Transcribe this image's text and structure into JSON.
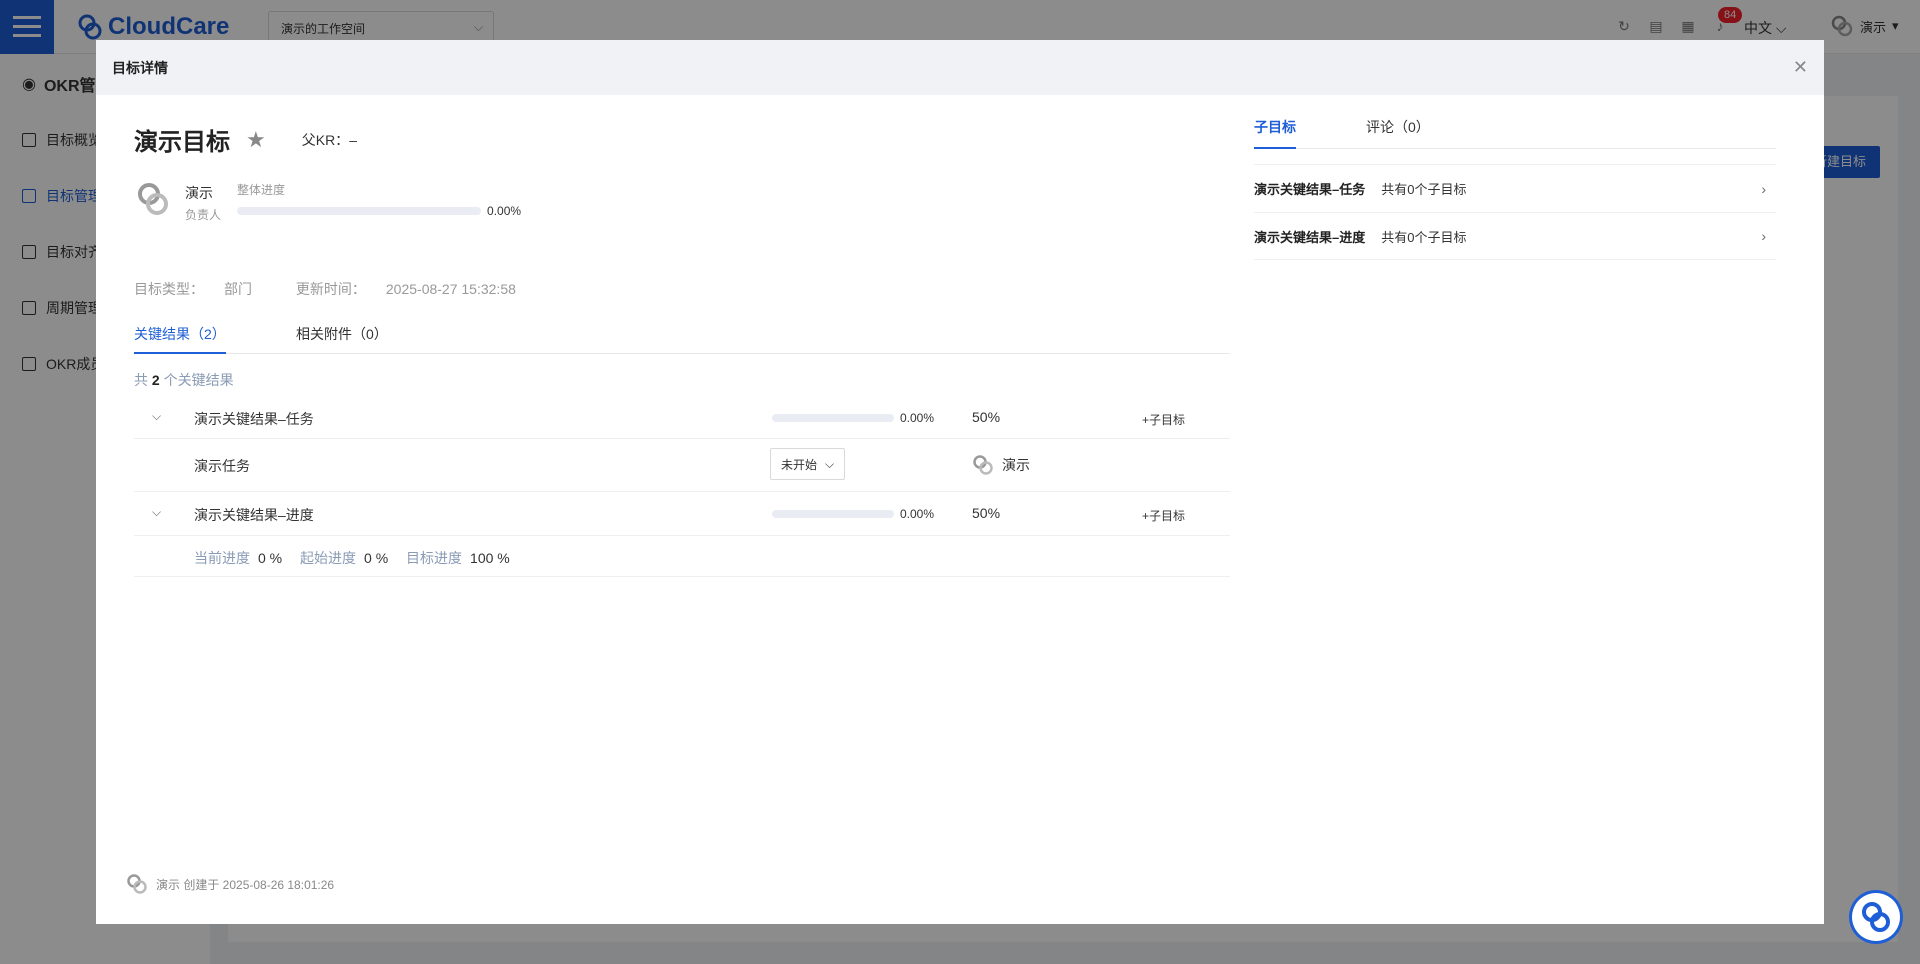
{
  "app": {
    "logo_text": "CloudCare",
    "workspace": "演示的工作空间",
    "notification_count": "84",
    "language": "中文",
    "user_name": "演示",
    "new_button": "新建目标"
  },
  "sidebar": {
    "title": "OKR管",
    "items": [
      {
        "label": "目标概览"
      },
      {
        "label": "目标管理"
      },
      {
        "label": "目标对齐"
      },
      {
        "label": "周期管理"
      },
      {
        "label": "OKR成员"
      }
    ]
  },
  "modal": {
    "title": "目标详情",
    "objective": {
      "name": "演示目标",
      "parent_kr_label": "父KR：",
      "parent_kr_value": "–",
      "owner_name": "演示",
      "owner_role": "负责人",
      "progress_label": "整体进度",
      "progress_value": "0.00%",
      "progress_fraction": 0.0,
      "type_label": "目标类型：",
      "type_value": "部门",
      "updated_label": "更新时间：",
      "updated_value": "2025-08-27 15:32:58"
    },
    "tabs": [
      {
        "label": "关键结果（2）"
      },
      {
        "label": "相关附件（0）"
      }
    ],
    "kr_count_prefix": "共",
    "kr_count_num": "2",
    "kr_count_suffix": "个关键结果",
    "key_results": [
      {
        "name": "演示关键结果–任务",
        "progress": "0.00%",
        "progress_fraction": 0.0,
        "weight": "50%",
        "add_label": "+子目标",
        "task": {
          "name": "演示任务",
          "status": "未开始",
          "assignee": "演示"
        }
      },
      {
        "name": "演示关键结果–进度",
        "progress": "0.00%",
        "progress_fraction": 0.0,
        "weight": "50%",
        "add_label": "+子目标",
        "detail": {
          "current_label": "当前进度",
          "current_value": "0 %",
          "start_label": "起始进度",
          "start_value": "0 %",
          "target_label": "目标进度",
          "target_value": "100 %"
        }
      }
    ],
    "creator": "演示 创建于 2025-08-26 18:01:26",
    "right_tabs": [
      {
        "label": "子目标"
      },
      {
        "label": "评论（0）"
      }
    ],
    "sub_objectives": [
      {
        "kr": "演示关键结果–任务",
        "count": "共有0个子目标"
      },
      {
        "kr": "演示关键结果–进度",
        "count": "共有0个子目标"
      }
    ]
  },
  "colors": {
    "accent": "#1e5ed6",
    "mask": "rgba(0,0,0,0.45)"
  }
}
